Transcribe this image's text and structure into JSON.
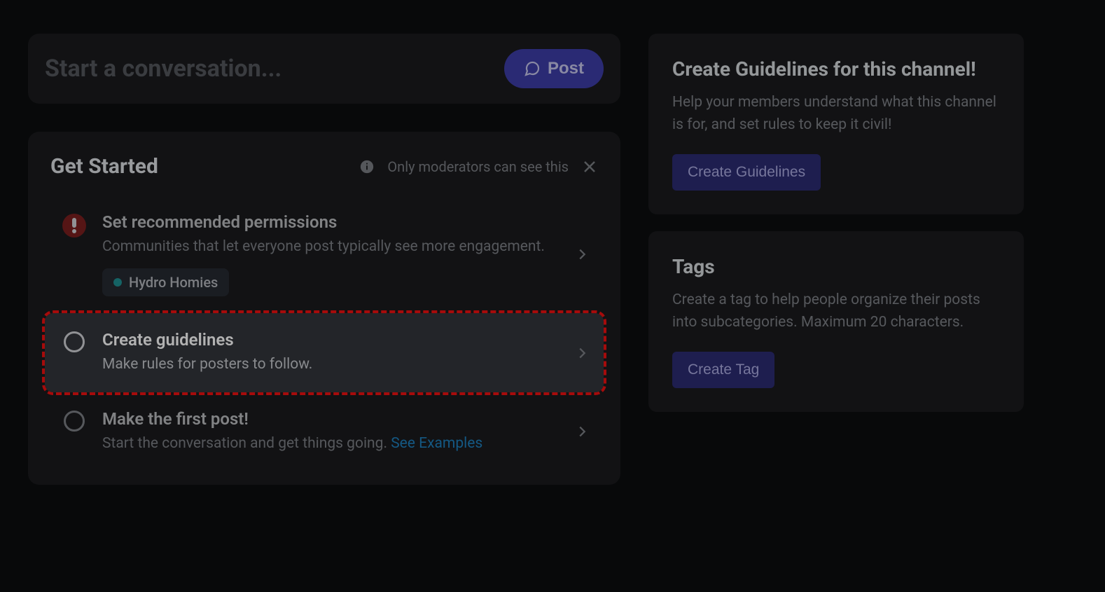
{
  "composer": {
    "placeholder": "Start a conversation...",
    "post_label": "Post"
  },
  "get_started": {
    "heading": "Get Started",
    "mod_notice": "Only moderators can see this",
    "steps": {
      "permissions": {
        "title": "Set recommended permissions",
        "sub": "Communities that let everyone post typically see more engagement.",
        "role_tag": "Hydro Homies"
      },
      "guidelines": {
        "title": "Create guidelines",
        "sub": "Make rules for posters to follow."
      },
      "first_post": {
        "title": "Make the first post!",
        "sub_prefix": "Start the conversation and get things going. ",
        "see_examples": "See Examples"
      }
    }
  },
  "side": {
    "guidelines_card": {
      "title": "Create Guidelines for this channel!",
      "body": "Help your members understand what this channel is for, and set rules to keep it civil!",
      "button": "Create Guidelines"
    },
    "tags_card": {
      "title": "Tags",
      "body": "Create a tag to help people organize their posts into subcategories. Maximum 20 characters.",
      "button": "Create Tag"
    }
  }
}
